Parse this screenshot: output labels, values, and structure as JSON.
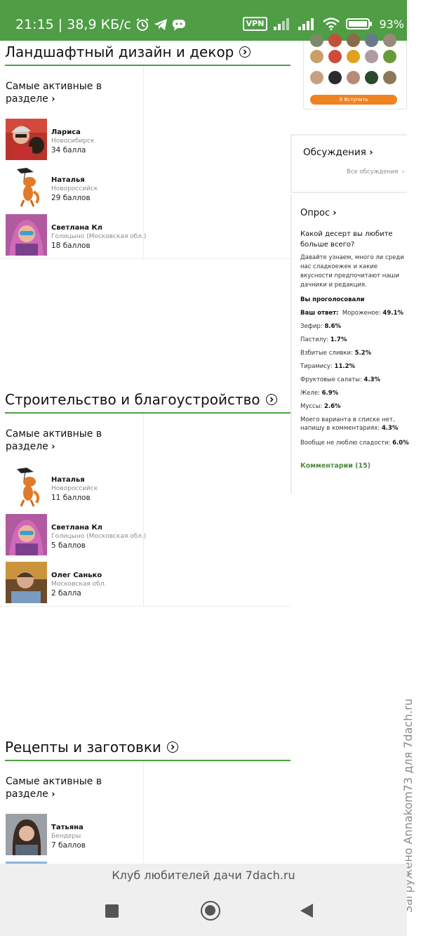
{
  "status_bar": {
    "time_speed": "21:15 | 38,9 КБ/с",
    "vpn": "VPN",
    "battery": "93%"
  },
  "sections": [
    {
      "title": "Ландшафтный дизайн и декор",
      "active_label": "Самые активные в разделе",
      "members": [
        {
          "name": "Лариса",
          "city": "Новосибирск",
          "points": "34 балла"
        },
        {
          "name": "Наталья",
          "city": "Новороссийск",
          "points": "29 баллов"
        },
        {
          "name": "Светлана Кл",
          "city": "Голицыно (Московская обл.)",
          "points": "18 баллов"
        }
      ]
    },
    {
      "title": "Строительство и благоустройство",
      "active_label": "Самые активные в разделе",
      "members": [
        {
          "name": "Наталья",
          "city": "Новороссийск",
          "points": "11 баллов"
        },
        {
          "name": "Светлана Кл",
          "city": "Голицыно (Московская обл.)",
          "points": "5 баллов"
        },
        {
          "name": "Олег Санько",
          "city": "Московская обл.",
          "points": "2 балла"
        }
      ]
    },
    {
      "title": "Рецепты и заготовки",
      "active_label": "Самые активные в разделе",
      "members": [
        {
          "name": "Татьяна",
          "city": "Бендеры",
          "points": "7 баллов"
        }
      ]
    }
  ],
  "group": {
    "join_label": "Вступить"
  },
  "discussions": {
    "title": "Обсуждения",
    "all_link": "Все обсуждения"
  },
  "poll": {
    "title": "Опрос",
    "question": "Какой десерт вы любите больше всего?",
    "description": "Давайте узнаем, много ли среди нас сладкоежек и какие вкусности предпочитают наши дачники и редакция.",
    "voted_label": "Вы проголосовали",
    "your_answer_label": "Ваш ответ:",
    "results": [
      {
        "label": "Мороженое:",
        "value": "49.1%"
      },
      {
        "label": "Зефир:",
        "value": "8.6%"
      },
      {
        "label": "Пастилу:",
        "value": "1.7%"
      },
      {
        "label": "Взбитые сливки:",
        "value": "5.2%"
      },
      {
        "label": "Тирамису:",
        "value": "11.2%"
      },
      {
        "label": "Фруктовые салаты:",
        "value": "4.3%"
      },
      {
        "label": "Желе:",
        "value": "6.9%"
      },
      {
        "label": "Муссы:",
        "value": "2.6%"
      },
      {
        "label": "Моего варианта в списке нет, напишу в комментариях:",
        "value": "4.3%"
      },
      {
        "label": "Вообще не люблю сладости:",
        "value": "6.0%"
      }
    ],
    "comments": "Комментарии (15)"
  },
  "url_bar": "Клуб любителей дачи 7dach.ru",
  "watermark": "Загружено Annakom73 для 7dach.ru",
  "colors": {
    "accent": "#4f9d45",
    "join": "#f08321",
    "link": "#4f8a3f"
  }
}
